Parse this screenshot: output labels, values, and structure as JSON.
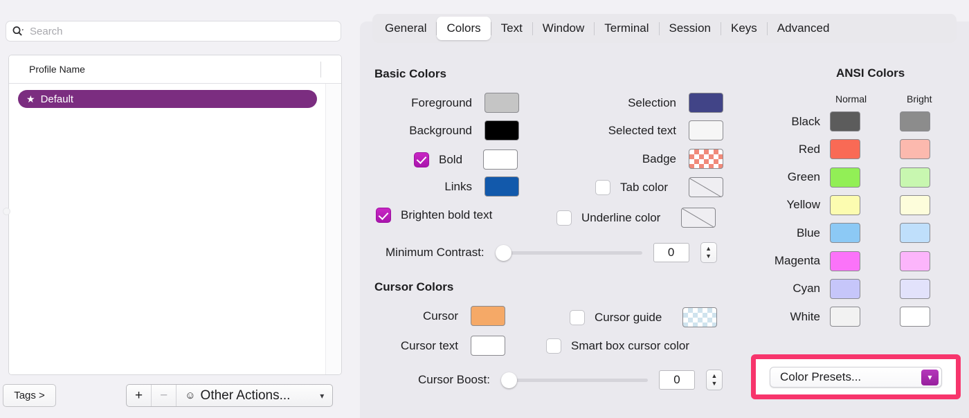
{
  "search": {
    "placeholder": "Search",
    "value": "",
    "icon": "search-magnifier-chevron-icon"
  },
  "profiles": {
    "column_header": "Profile Name",
    "rows": [
      {
        "name": "Default",
        "icon": "star-icon",
        "selected": true
      }
    ]
  },
  "bottom_bar": {
    "tags_label": "Tags >",
    "add_label": "+",
    "remove_label": "−",
    "other_actions_label": "Other Actions...",
    "other_actions_icon": "circled-ellipsis-icon",
    "chevron": "⌄"
  },
  "tabs": [
    {
      "label": "General",
      "active": false
    },
    {
      "label": "Colors",
      "active": true
    },
    {
      "label": "Text",
      "active": false
    },
    {
      "label": "Window",
      "active": false
    },
    {
      "label": "Terminal",
      "active": false
    },
    {
      "label": "Session",
      "active": false
    },
    {
      "label": "Keys",
      "active": false
    },
    {
      "label": "Advanced",
      "active": false
    }
  ],
  "basic_colors": {
    "title": "Basic Colors",
    "left": [
      {
        "label": "Foreground",
        "color": "#c5c5c5",
        "checkbox": null
      },
      {
        "label": "Background",
        "color": "#000000",
        "checkbox": null
      },
      {
        "label": "Bold",
        "color": "#ffffff",
        "checkbox": true
      },
      {
        "label": "Links",
        "color": "#1259ab",
        "checkbox": null
      }
    ],
    "right": [
      {
        "label": "Selection",
        "color": "#414487",
        "checkbox": null
      },
      {
        "label": "Selected text",
        "color": "#f6f6f6",
        "checkbox": null
      },
      {
        "label": "Badge",
        "color": "#f08a7a",
        "checkbox": null,
        "pattern": "checker"
      },
      {
        "label": "Tab color",
        "color": null,
        "checkbox": false,
        "pattern": "none"
      }
    ],
    "brighten_bold_text": {
      "label": "Brighten bold text",
      "checked": true
    },
    "underline_color": {
      "label": "Underline color",
      "checked": false,
      "color": null,
      "pattern": "none"
    },
    "minimum_contrast": {
      "label": "Minimum Contrast:",
      "value": "0",
      "slider_position": 0
    }
  },
  "cursor_colors": {
    "title": "Cursor Colors",
    "cursor": {
      "label": "Cursor",
      "color": "#f5a967"
    },
    "cursor_text": {
      "label": "Cursor text",
      "color": "#ffffff"
    },
    "cursor_guide": {
      "label": "Cursor guide",
      "checked": false,
      "color": "#cfe3ee",
      "pattern": "checker"
    },
    "smart_box_cursor_color": {
      "label": "Smart box cursor color",
      "checked": false
    },
    "cursor_boost": {
      "label": "Cursor Boost:",
      "value": "0",
      "slider_position": 0
    }
  },
  "ansi_colors": {
    "title": "ANSI Colors",
    "col_normal": "Normal",
    "col_bright": "Bright",
    "rows": [
      {
        "name": "Black",
        "normal": "#5c5c5c",
        "bright": "#8c8c8c"
      },
      {
        "name": "Red",
        "normal": "#f96a55",
        "bright": "#fcb9ae"
      },
      {
        "name": "Green",
        "normal": "#92ef56",
        "bright": "#c8f7b0"
      },
      {
        "name": "Yellow",
        "normal": "#fcfcb0",
        "bright": "#fdfddb"
      },
      {
        "name": "Blue",
        "normal": "#8cc9f5",
        "bright": "#bfdffb"
      },
      {
        "name": "Magenta",
        "normal": "#fb73f9",
        "bright": "#fcb5fb"
      },
      {
        "name": "Cyan",
        "normal": "#c6c6fa",
        "bright": "#e2e2fb"
      },
      {
        "name": "White",
        "normal": "#f2f2f2",
        "bright": "#ffffff"
      }
    ]
  },
  "color_presets": {
    "label": "Color Presets...",
    "chevron": "⌄",
    "highlight_color": "#f7356c"
  }
}
